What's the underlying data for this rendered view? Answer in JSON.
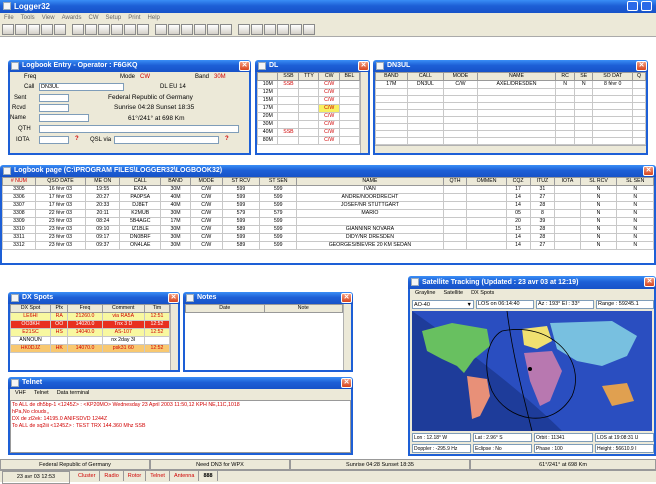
{
  "app": {
    "title": "Logger32"
  },
  "menu": [
    "File",
    "Tools",
    "View",
    "Awards",
    "CW",
    "Setup",
    "Print",
    "Help"
  ],
  "toolbar_icons": [
    "new-log-icon",
    "open-log-icon",
    "edit-icon",
    "layout-icon",
    "grid-icon",
    "map-icon",
    "spot-icon",
    "settings-icon",
    "print-icon",
    "radio-icon",
    "table-icon",
    "table2-icon",
    "chart-icon",
    "doc-icon",
    "globe-icon",
    "clock-icon",
    "gear-icon",
    "window-icon",
    "window2-icon",
    "window3-icon",
    "user-icon",
    "save-icon",
    "info-icon"
  ],
  "entry": {
    "title": "Logbook Entry - Operator : F6GKQ",
    "freq_label": "Freq",
    "mode_label": "Mode",
    "mode_value": "CW",
    "band_label": "Band",
    "band_value": "30M",
    "call_label": "Call",
    "call_value": "DN3UL",
    "dl_info": "DL EU 14",
    "sent_label": "Sent",
    "rcvd_label": "Rcvd",
    "name_label": "Name",
    "qth_label": "QTH",
    "iota_label": "IOTA",
    "country": "Federal Republic of Germany",
    "sun": "Sunrise 04:28 Sunset 18:35",
    "bearing": "61°/241° at 698 Km",
    "qsl_label": "QSL via",
    "qmark": "?"
  },
  "bands": {
    "title": "DL",
    "headers": [
      "",
      "SSB",
      "TTY",
      "CW",
      "BEL"
    ],
    "rows": [
      [
        "10M",
        "SSB",
        "",
        "C/W",
        ""
      ],
      [
        "12M",
        "",
        "",
        "C/W",
        ""
      ],
      [
        "15M",
        "",
        "",
        "C/W",
        ""
      ],
      [
        "17M",
        "",
        "",
        "C/W",
        ""
      ],
      [
        "20M",
        "",
        "",
        "C/W",
        ""
      ],
      [
        "30M",
        "",
        "",
        "C/W",
        ""
      ],
      [
        "40M",
        "SSB",
        "",
        "C/W",
        ""
      ],
      [
        "80M",
        "",
        "",
        "C/W",
        ""
      ]
    ]
  },
  "dn3ul": {
    "title": "DN3UL",
    "headers": [
      "BAND",
      "CALL",
      "MODE",
      "NAME",
      "RC",
      "SE",
      "SO DAT",
      "Q"
    ],
    "rows": [
      [
        "17M",
        "DN3UL",
        "C/W",
        "AXEL/DRESDEN",
        "N",
        "N",
        "8 févr 0",
        ""
      ]
    ]
  },
  "logbook": {
    "title": "Logbook page (C:\\PROGRAM FILES\\LOGGER32\\LOGBOOK32)",
    "headers": [
      "# NUM",
      "QSO DATE",
      "ME ON",
      "CALL",
      "BAND",
      "MODE",
      "ST RCV",
      "ST SEN",
      "NAME",
      "QTH",
      "OMMEN",
      "CQZ",
      "ITUZ",
      "IOTA",
      "SL RCV",
      "SL SEN"
    ],
    "rows": [
      [
        "3305",
        "16 févr 03",
        "19:55",
        "EX2A",
        "30M",
        "C/W",
        "599",
        "599",
        "IVAN",
        "",
        "",
        "17",
        "31",
        "",
        "N",
        "N"
      ],
      [
        "3306",
        "17 févr 03",
        "20:27",
        "PA0PSA",
        "40M",
        "C/W",
        "599",
        "599",
        "ANDRE/NOORDRECHT",
        "",
        "",
        "14",
        "27",
        "",
        "N",
        "N"
      ],
      [
        "3307",
        "17 févr 03",
        "20:33",
        "DJ8ET",
        "40M",
        "C/W",
        "599",
        "599",
        "JOSEF/NR STUTTGART",
        "",
        "",
        "14",
        "28",
        "",
        "N",
        "N"
      ],
      [
        "3308",
        "22 févr 03",
        "20:11",
        "K2MUB",
        "30M",
        "C/W",
        "579",
        "579",
        "MARIO",
        "",
        "",
        "05",
        "8",
        "",
        "N",
        "N"
      ],
      [
        "3309",
        "23 févr 03",
        "08:24",
        "5B4AGC",
        "17M",
        "C/W",
        "599",
        "599",
        "",
        "",
        "",
        "20",
        "39",
        "",
        "N",
        "N"
      ],
      [
        "3310",
        "23 févr 03",
        "09:10",
        "IZ1BLE",
        "30M",
        "C/W",
        "589",
        "599",
        "GIANNINR NOVARA",
        "",
        "",
        "15",
        "28",
        "",
        "N",
        "N"
      ],
      [
        "3311",
        "23 févr 03",
        "09:17",
        "DN0BRF",
        "30M",
        "C/W",
        "599",
        "599",
        "DIDY/NR DRESDEN",
        "",
        "",
        "14",
        "28",
        "",
        "N",
        "N"
      ],
      [
        "3312",
        "23 févr 03",
        "09:37",
        "ON4LAE",
        "30M",
        "C/W",
        "589",
        "599",
        "GEORGES/BIEVRE 20 KM SEDAN",
        "",
        "",
        "14",
        "27",
        "",
        "N",
        "N"
      ]
    ]
  },
  "dxspots": {
    "title": "DX Spots",
    "headers": [
      "DX Spot",
      "Pfx",
      "Freq",
      "Comment",
      "Tim"
    ],
    "rows": [
      {
        "c": [
          "LE6HI",
          "RA",
          "21260.0",
          "via RA5A",
          "12:51"
        ],
        "bg": "#f8f8a0",
        "fg": "#d00000"
      },
      {
        "c": [
          "OO3KH",
          "OO",
          "14020.0",
          "Tnx 3 D",
          "12:52"
        ],
        "bg": "#e83020",
        "fg": "#ffffff"
      },
      {
        "c": [
          "E21SC",
          "HS",
          "14040.0",
          "AS-107",
          "12:52"
        ],
        "bg": "#f8f8a0",
        "fg": "#d00000"
      },
      {
        "c": [
          "ANNOUN",
          "",
          "",
          "nx 2day 3I",
          ""
        ],
        "bg": "#ffffff",
        "fg": "#000000"
      },
      {
        "c": [
          "HK0DJZ",
          "HK",
          "14070.0",
          "psk31 60",
          "12:52"
        ],
        "bg": "#f8c870",
        "fg": "#d00000"
      }
    ]
  },
  "notes": {
    "title": "Notes",
    "headers": [
      "Date",
      "Note"
    ]
  },
  "telnet": {
    "title": "Telnet",
    "tabs": [
      "VHF",
      "Telnet",
      "Data terminal"
    ],
    "lines": [
      "To ALL de dh5bp-1 <1245Z> : <KP20MO> Wednesday 23 April 2003 11:50,12 KPH NE,11C,1018",
      "hPa,No clouds,,",
      "DX de zl2ek:    14195.0  ANIFSDVD            1244Z",
      "To ALL de sq2iii <1245Z> : TEST TRX 144.360 Mhz SSB"
    ]
  },
  "satellite": {
    "title": "Satellite Tracking (Updated : 23 avr 03 at 12:19)",
    "tabs": [
      "Grayline",
      "Satellite",
      "DX Spots"
    ],
    "sat_name": "AO-40",
    "los": "LOS on 06:14:40",
    "az_el": "Az : 193°  El : 33°",
    "range": "Range : 59245.1",
    "info1": [
      "Lon : 12.18° W",
      "Lat : 2.96° S",
      "Orbit : 11341",
      "LOS at 19:08:31 U"
    ],
    "info2": [
      "Doppler : -295.9 Hz",
      "Eclipse : No",
      "Phase : 100",
      "Height : 56610.9 I"
    ]
  },
  "status": {
    "cells": [
      "Federal Republic of Germany",
      "Need DN3 for WPX",
      "Sunrise 04:28 Sunset 18:35",
      "61°/241° at 698 Km"
    ],
    "date": "23 avr 03 12:53",
    "buttons": [
      "Cluster",
      "Radio",
      "Rotor",
      "Telnet",
      "Antenna"
    ],
    "extra": "888"
  },
  "colors": {
    "title_blue": "#1d5fd6",
    "warn_red": "#d00000",
    "desktop": "#ffffff"
  }
}
